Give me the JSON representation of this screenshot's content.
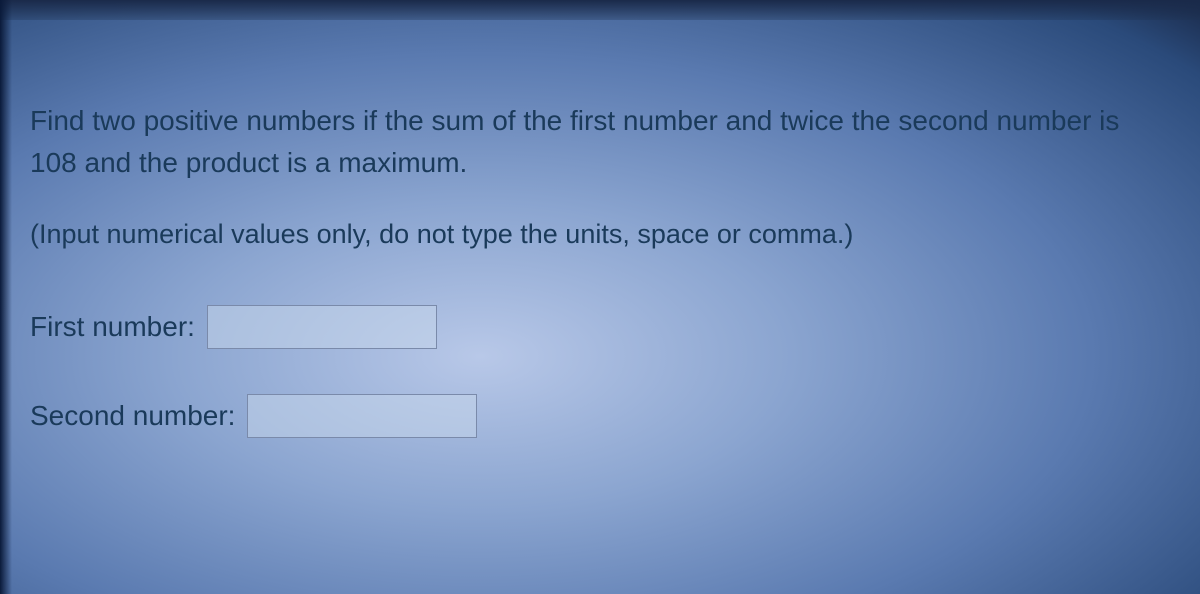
{
  "question": {
    "text": "Find two positive numbers if the sum of the first number and twice the second number is 108 and the product is a maximum.",
    "instruction": "(Input numerical values only, do not type the units, space or comma.)"
  },
  "answers": {
    "first": {
      "label": "First number:",
      "value": ""
    },
    "second": {
      "label": "Second number:",
      "value": ""
    }
  }
}
